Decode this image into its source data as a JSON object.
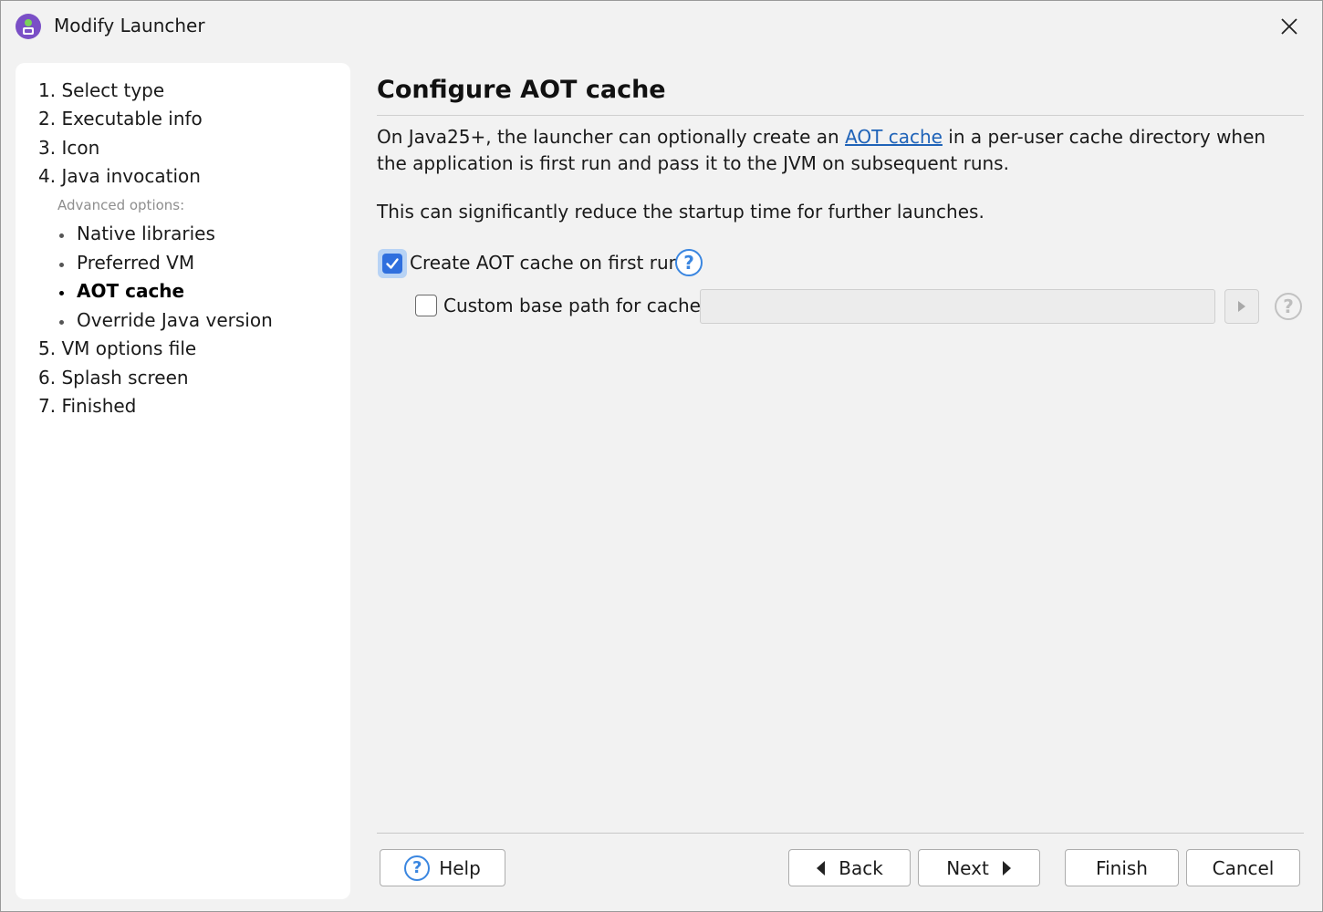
{
  "window": {
    "title": "Modify Launcher"
  },
  "sidebar": {
    "steps": [
      "1. Select type",
      "2. Executable info",
      "3. Icon",
      "4. Java invocation",
      "5. VM options file",
      "6. Splash screen",
      "7. Finished"
    ],
    "advanced_label": "Advanced options:",
    "advanced_items": [
      "Native libraries",
      "Preferred VM",
      "AOT cache",
      "Override Java version"
    ],
    "active_item": "AOT cache"
  },
  "main": {
    "heading": "Configure AOT cache",
    "description_before_link": "On Java25+, the launcher can optionally create an ",
    "description_link": "AOT cache",
    "description_after_link": " in a per-user cache directory when the application is first run and pass it to the JVM on subsequent runs.",
    "description_2": "This can significantly reduce the startup time for further launches.",
    "create_cache_label": "Create AOT cache on first run",
    "create_cache_checked": true,
    "custom_path_label": "Custom base path for cache:",
    "custom_path_checked": false,
    "custom_path_value": ""
  },
  "buttons": {
    "help": "Help",
    "back": "Back",
    "next": "Next",
    "finish": "Finish",
    "cancel": "Cancel"
  },
  "colors": {
    "accent": "#2f6fde",
    "link": "#1f63b8",
    "app_icon": "#7a4fc6"
  }
}
